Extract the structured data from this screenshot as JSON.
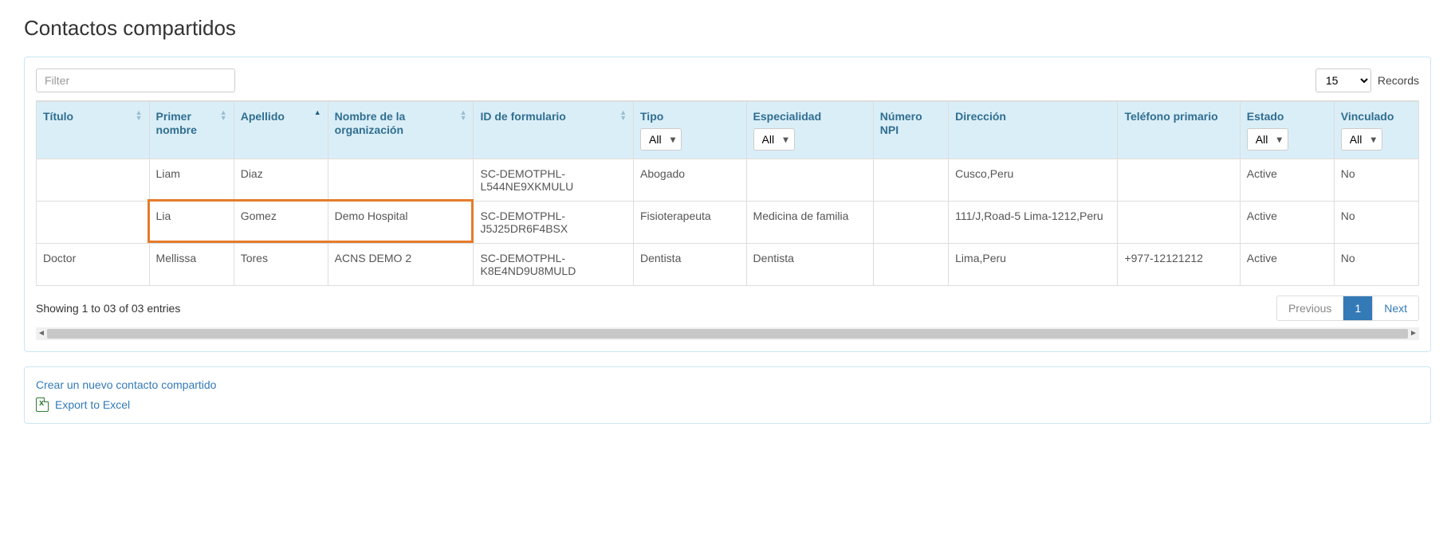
{
  "title": "Contactos compartidos",
  "filter": {
    "placeholder": "Filter",
    "value": ""
  },
  "records": {
    "selected": "15",
    "label": "Records"
  },
  "columns": {
    "titulo": "Título",
    "primer_nombre": "Primer nombre",
    "apellido": "Apellido",
    "org": "Nombre de la organización",
    "form_id": "ID de formulario",
    "tipo": "Tipo",
    "especialidad": "Especialidad",
    "npi": "Número NPI",
    "direccion": "Dirección",
    "telefono": "Teléfono primario",
    "estado": "Estado",
    "vinculado": "Vinculado"
  },
  "dropdown_all": "All",
  "rows": [
    {
      "titulo": "",
      "primer_nombre": "Liam",
      "apellido": "Diaz",
      "org": "",
      "form_id": "SC-DEMOTPHL-L544NE9XKMULU",
      "tipo": "Abogado",
      "especialidad": "",
      "npi": "",
      "direccion": "Cusco,Peru",
      "telefono": "",
      "estado": "Active",
      "vinculado": "No"
    },
    {
      "titulo": "",
      "primer_nombre": "Lia",
      "apellido": "Gomez",
      "org": "Demo Hospital",
      "form_id": "SC-DEMOTPHL-J5J25DR6F4BSX",
      "tipo": "Fisioterapeuta",
      "especialidad": "Medicina de familia",
      "npi": "",
      "direccion": "111/J,Road-5 Lima-1212,Peru",
      "telefono": "",
      "estado": "Active",
      "vinculado": "No"
    },
    {
      "titulo": "Doctor",
      "primer_nombre": "Mellissa",
      "apellido": "Tores",
      "org": "ACNS DEMO 2",
      "form_id": "SC-DEMOTPHL-K8E4ND9U8MULD",
      "tipo": "Dentista",
      "especialidad": "Dentista",
      "npi": "",
      "direccion": "Lima,Peru",
      "telefono": "+977-12121212",
      "estado": "Active",
      "vinculado": "No"
    }
  ],
  "showing": "Showing 1 to 03 of 03 entries",
  "pagination": {
    "previous": "Previous",
    "page": "1",
    "next": "Next"
  },
  "actions": {
    "create": "Crear un nuevo contacto compartido",
    "export": "Export to Excel"
  }
}
